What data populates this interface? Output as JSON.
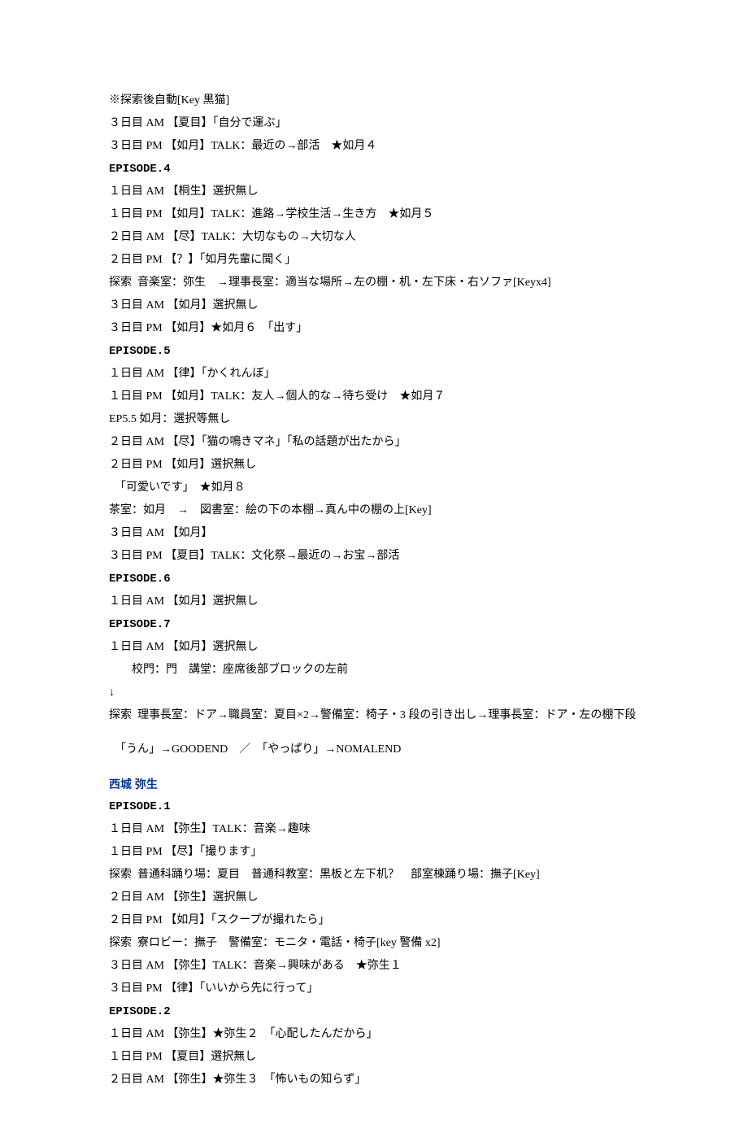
{
  "lines": [
    {
      "text": "※探索後自動[Key 黒猫]"
    },
    {
      "text": "３日目 AM 【夏目】「自分で運ぶ」"
    },
    {
      "text": "３日目 PM 【如月】TALK：最近の→部活　★如月４"
    },
    {
      "text": "EPISODE.4",
      "class": "mono heading"
    },
    {
      "text": "１日目 AM 【桐生】選択無し"
    },
    {
      "text": "１日目 PM 【如月】TALK：進路→学校生活→生き方　★如月５"
    },
    {
      "text": "２日目 AM 【尽】TALK：大切なもの→大切な人"
    },
    {
      "text": "２日目 PM 【？】「如月先輩に聞く」"
    },
    {
      "text": "探索  音楽室：弥生　→理事長室：適当な場所→左の棚・机・左下床・右ソファ[Keyx4]"
    },
    {
      "text": "３日目 AM 【如月】選択無し"
    },
    {
      "text": "３日目 PM 【如月】★如月６　「出す」"
    },
    {
      "text": "EPISODE.5",
      "class": "mono heading"
    },
    {
      "text": "１日目 AM 【律】「かくれんぼ」"
    },
    {
      "text": "１日目 PM 【如月】TALK：友人→個人的な→待ち受け　★如月７"
    },
    {
      "text": "EP5.5 如月：選択等無し"
    },
    {
      "text": "２日目 AM 【尽】「猫の鳴きマネ」「私の話題が出たから」"
    },
    {
      "text": "２日目 PM 【如月】選択無し"
    },
    {
      "text": "　「可愛いです」　★如月８"
    },
    {
      "text": "茶室：如月　→　図書室：絵の下の本棚→真ん中の棚の上[Key]"
    },
    {
      "text": "３日目 AM 【如月】"
    },
    {
      "text": "３日目 PM 【夏目】TALK：文化祭→最近の→お宝→部活"
    },
    {
      "text": "EPISODE.6",
      "class": "mono heading"
    },
    {
      "text": "１日目 AM 【如月】選択無し"
    },
    {
      "text": "EPISODE.7",
      "class": "mono heading"
    },
    {
      "text": "１日目 AM 【如月】選択無し"
    },
    {
      "text": "　　校門：門　講堂：座席後部ブロックの左前"
    },
    {
      "text": "↓"
    },
    {
      "text": "探索  理事長室：ドア→職員室：夏目×2→警備室：椅子・3 段の引き出し→理事長室：ドア・左の棚下段"
    },
    {
      "text": "",
      "class": "spacer"
    },
    {
      "text": "　「うん」→GOODEND　／　「やっぱり」→NOMALEND"
    },
    {
      "text": "",
      "class": "spacer"
    },
    {
      "text": "西城 弥生",
      "class": "character"
    },
    {
      "text": "EPISODE.1",
      "class": "mono heading"
    },
    {
      "text": "１日目 AM 【弥生】TALK：音楽→趣味"
    },
    {
      "text": "１日目 PM 【尽】「撮ります」"
    },
    {
      "text": "探索  普通科踊り場：夏目　普通科教室：黒板と左下机？　部室棟踊り場：撫子[Key]"
    },
    {
      "text": "２日目 AM 【弥生】選択無し"
    },
    {
      "text": "２日目 PM 【如月】「スクープが撮れたら」"
    },
    {
      "text": "探索  寮ロビー：撫子　警備室：モニタ・電話・椅子[key 警備 x2]"
    },
    {
      "text": "３日目 AM 【弥生】TALK：音楽→興味がある　★弥生１"
    },
    {
      "text": "３日目 PM 【律】「いいから先に行って」"
    },
    {
      "text": "EPISODE.2",
      "class": "mono heading"
    },
    {
      "text": "１日目 AM 【弥生】★弥生２　「心配したんだから」"
    },
    {
      "text": "１日目 PM 【夏目】選択無し"
    },
    {
      "text": "２日目 AM 【弥生】★弥生３　「怖いもの知らず」"
    }
  ]
}
